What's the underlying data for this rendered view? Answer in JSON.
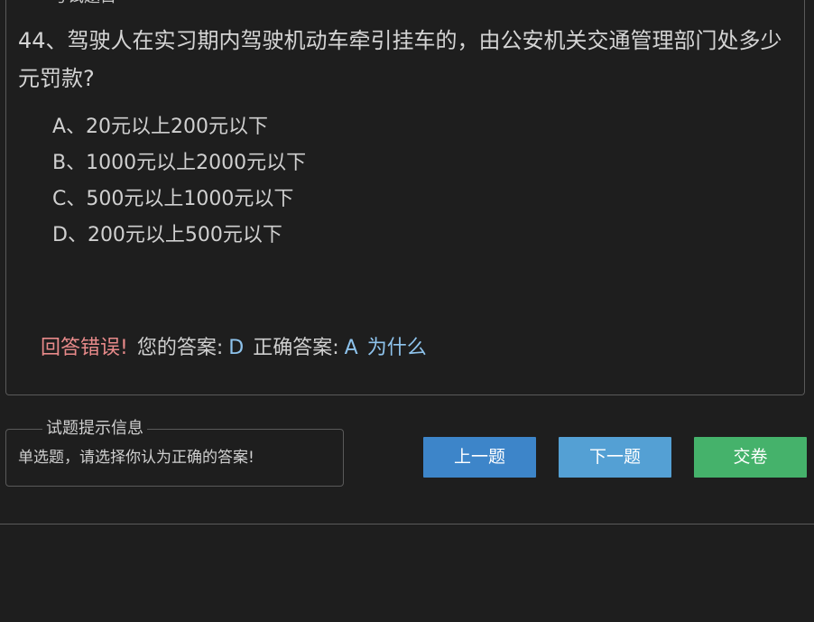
{
  "question_section": {
    "legend": "考试题目",
    "question": "44、驾驶人在实习期内驾驶机动车牵引挂车的，由公安机关交通管理部门处多少元罚款?",
    "options": [
      {
        "label": "A、20元以上200元以下"
      },
      {
        "label": "B、1000元以上2000元以下"
      },
      {
        "label": "C、500元以上1000元以下"
      },
      {
        "label": "D、200元以上500元以下"
      }
    ],
    "result": {
      "status": "回答错误!",
      "your_answer_label": "您的答案:",
      "your_answer": "D",
      "correct_answer_label": "正确答案:",
      "correct_answer": "A",
      "why_link": "为什么"
    }
  },
  "hint_section": {
    "legend": "试题提示信息",
    "text": "单选题，请选择你认为正确的答案!"
  },
  "buttons": {
    "prev": "上一题",
    "next": "下一题",
    "submit": "交卷"
  },
  "colors": {
    "background": "#1e1e1e",
    "wrong": "#e88a8a",
    "answer": "#8ec3ec",
    "prev_button": "#3d85c9",
    "next_button": "#54a0d4",
    "submit_button": "#45b26b"
  }
}
